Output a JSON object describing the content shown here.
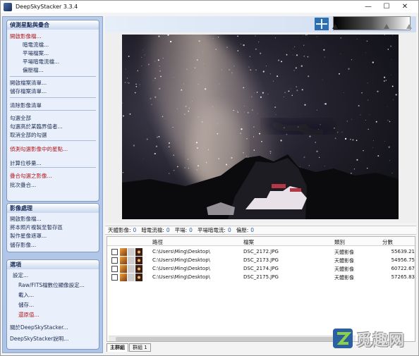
{
  "window": {
    "title": "DeepSkyStacker 3.3.4",
    "controls": [
      "—",
      "☐",
      "✕"
    ]
  },
  "left_panel": {
    "registering": {
      "header": "偵測星點與疊合",
      "items": [
        {
          "label": "開啟影像檔...",
          "red": true
        },
        {
          "label": "暗電流檔...",
          "red": false
        },
        {
          "label": "平場檔案...",
          "red": false
        },
        {
          "label": "平場暗電流檔...",
          "red": false
        },
        {
          "label": "偏壓檔...",
          "red": false
        },
        {
          "label": "開啟檔案清單...",
          "red": false
        },
        {
          "label": "儲存檔案清單...",
          "red": false
        },
        {
          "label": "清除影像清單",
          "red": false
        },
        {
          "label": "勾選全部",
          "red": false
        },
        {
          "label": "勾選高於某臨界值者...",
          "red": false
        },
        {
          "label": "取消全部的勾選",
          "red": false
        },
        {
          "label": "偵測勾選影像中的星點...",
          "red": true
        },
        {
          "label": "計算位移量...",
          "red": false
        },
        {
          "label": "疊合勾選之影像...",
          "red": true
        },
        {
          "label": "批次疊合...",
          "red": false
        }
      ]
    },
    "processing": {
      "header": "影像處理",
      "items": [
        "開啟影像檔...",
        "將本照片複製至暫存區",
        "製作星像遮罩...",
        "儲存影像..."
      ]
    },
    "options": {
      "header": "選項",
      "items": [
        {
          "label": "設定...",
          "red": false
        },
        {
          "label": "Raw/FITS檔數位顯像設定...",
          "red": false
        },
        {
          "label": "載入...",
          "red": false
        },
        {
          "label": "儲存...",
          "red": false
        },
        {
          "label": "還原值...",
          "red": true
        },
        {
          "label": "關於DeepSkyStacker...",
          "red": false
        },
        {
          "label": "DeepSkyStacker說明...",
          "red": false
        }
      ]
    }
  },
  "status": [
    {
      "label": "天體影像:",
      "value": "0"
    },
    {
      "label": "暗電流檔:",
      "value": "0"
    },
    {
      "label": "平場:",
      "value": "0"
    },
    {
      "label": "平場暗電流:",
      "value": "0"
    },
    {
      "label": "偏壓:",
      "value": "0"
    }
  ],
  "table": {
    "columns": [
      "路徑",
      "檔案",
      "類別",
      "分數"
    ],
    "rows": [
      {
        "path": "C:\\Users\\Ming\\Desktop\\",
        "file": "DSC_2172.JPG",
        "type": "天體影像",
        "score": "55639.21"
      },
      {
        "path": "C:\\Users\\Ming\\Desktop\\",
        "file": "DSC_2173.JPG",
        "type": "天體影像",
        "score": "54956.75"
      },
      {
        "path": "C:\\Users\\Ming\\Desktop\\",
        "file": "DSC_2174.JPG",
        "type": "天體影像",
        "score": "60722.67"
      },
      {
        "path": "C:\\Users\\Ming\\Desktop\\",
        "file": "DSC_2175.JPG",
        "type": "天體影像",
        "score": "57265.83"
      }
    ]
  },
  "tabs": [
    "主群組",
    "群組 1"
  ],
  "watermark": "觅趣网",
  "colors": {
    "panel": "#aec4e6",
    "accent_red": "#b0181c",
    "status_value": "#2a5db0"
  }
}
